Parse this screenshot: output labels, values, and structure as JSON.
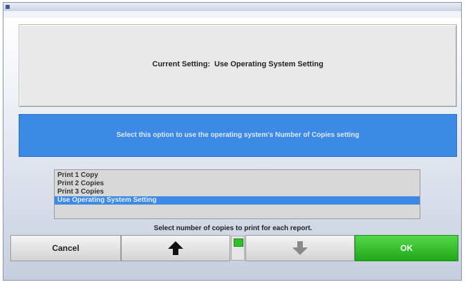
{
  "window": {
    "title": "",
    "subtitle": "",
    "controls": ""
  },
  "current_setting": {
    "label": "Current Setting:",
    "value": "Use Operating System Setting"
  },
  "info_banner": {
    "text": "Select this option to use the operating system's Number of Copies setting"
  },
  "copies_list": {
    "items": [
      {
        "label": "Print 1 Copy",
        "selected": false
      },
      {
        "label": "Print 2 Copies",
        "selected": false
      },
      {
        "label": "Print 3 Copies",
        "selected": false
      },
      {
        "label": "Use Operating System Setting",
        "selected": true
      }
    ]
  },
  "hint": "Select number of copies to print for each report.",
  "buttons": {
    "cancel": "Cancel",
    "up_icon": "arrow-up-icon",
    "down_icon": "arrow-down-icon",
    "ok": "OK"
  },
  "colors": {
    "accent_blue": "#3d8ae6",
    "ok_green": "#21a81b",
    "arrow_enabled": "#111111",
    "arrow_disabled": "#8a8a8a"
  }
}
